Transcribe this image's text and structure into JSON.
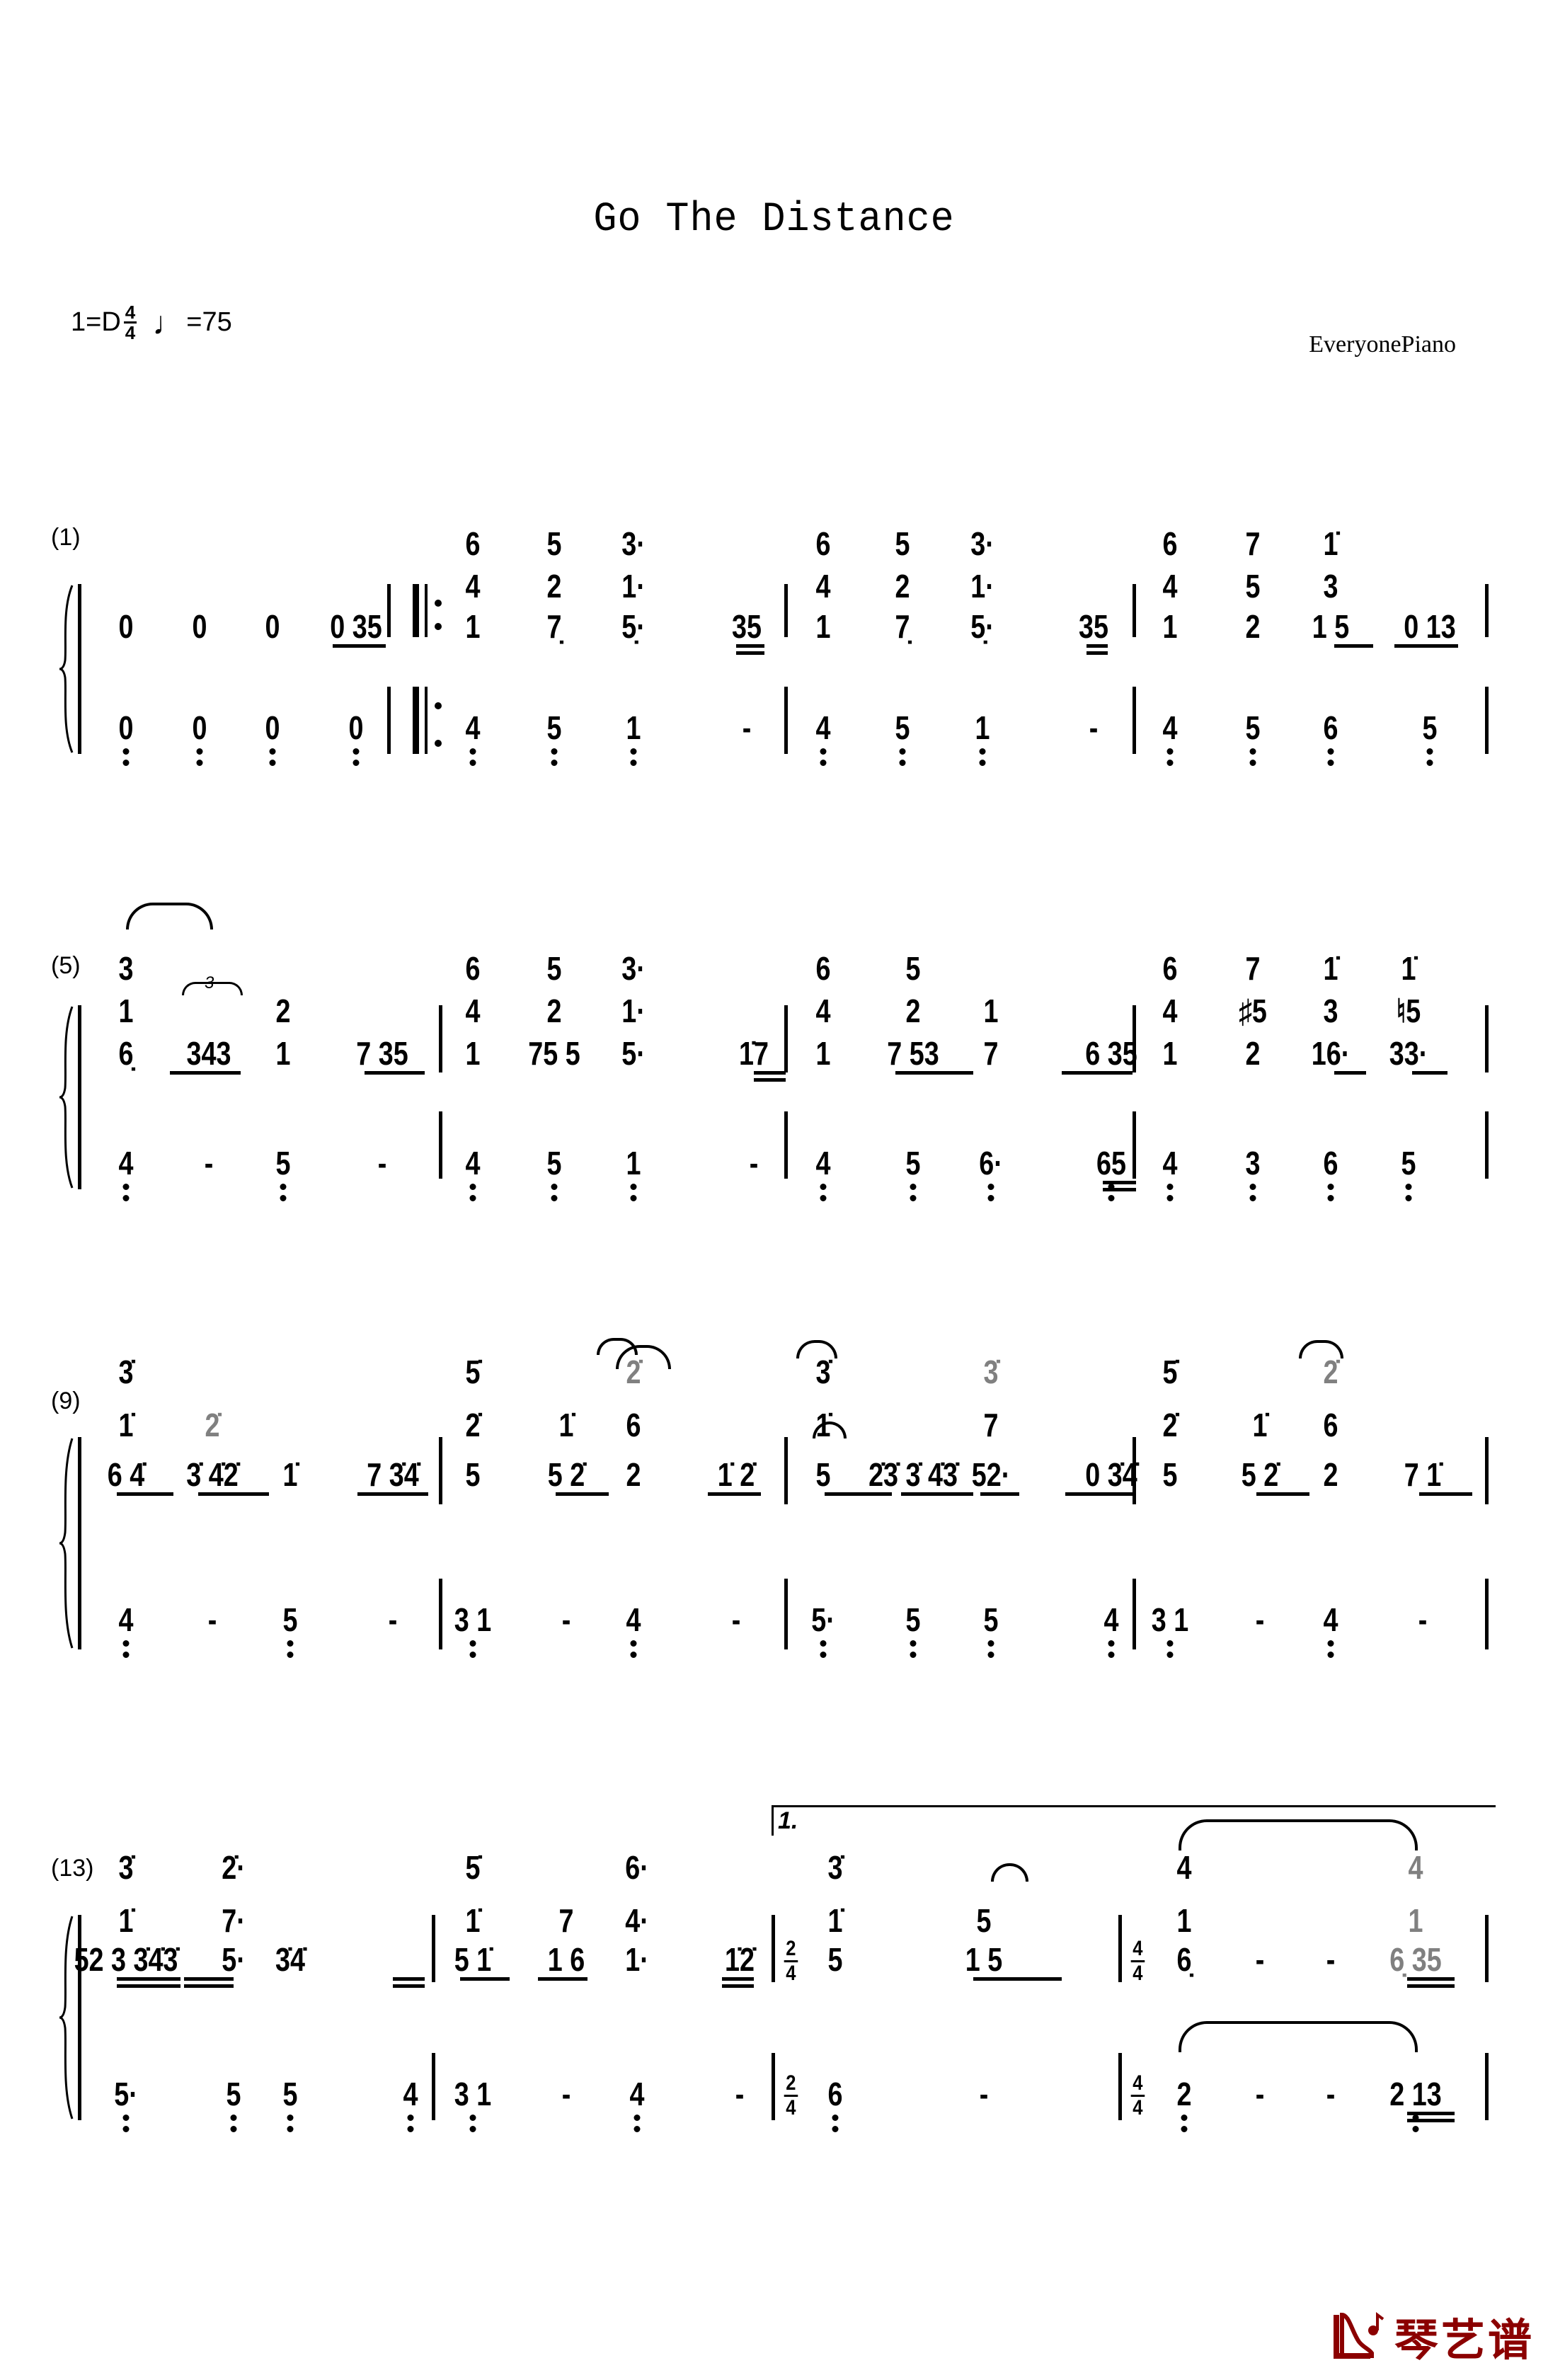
{
  "title": "Go The Distance",
  "key": "1=D",
  "time_signature": {
    "num": "4",
    "den": "4"
  },
  "tempo_symbol": "♩",
  "tempo": "=75",
  "arranger": "EveryonePiano",
  "logo": {
    "icon": "piano-note-icon",
    "text": "琴艺谱",
    "color": "#8b0000"
  },
  "systems": [
    {
      "bar_number": "(1)",
      "measures": [
        {
          "treble": [
            "0",
            "0",
            "0",
            "0 35"
          ],
          "bass": [
            "0",
            "0",
            "0",
            "0"
          ]
        },
        {
          "treble_chords": [
            [
              "1",
              "4",
              "6"
            ],
            [
              "7̣",
              "2",
              "5"
            ],
            [
              "5̣·",
              "1·",
              "3·"
            ],
            [
              "35"
            ]
          ],
          "bass": [
            "4",
            "5",
            "1",
            "-"
          ],
          "start": "repeat-open"
        },
        {
          "treble_chords": [
            [
              "1",
              "4",
              "6"
            ],
            [
              "7̣",
              "2",
              "5"
            ],
            [
              "5̣·",
              "1·",
              "3·"
            ],
            [
              "35"
            ]
          ],
          "bass": [
            "4",
            "5",
            "1",
            "-"
          ]
        },
        {
          "treble_chords": [
            [
              "1",
              "4",
              "6"
            ],
            [
              "2",
              "5",
              "7"
            ],
            [
              "1 5",
              "3",
              "1̇"
            ],
            [
              "0 13"
            ]
          ],
          "bass": [
            "4",
            "5",
            "6",
            "5"
          ]
        }
      ]
    },
    {
      "bar_number": "(5)",
      "measures": [
        {
          "treble_chords": [
            [
              "6̣",
              "1",
              "3"
            ],
            [
              "343"
            ],
            [
              "1",
              "2"
            ],
            [
              "7 35"
            ]
          ],
          "bass": [
            "4",
            "-",
            "5",
            "-"
          ],
          "tuplet": "3"
        },
        {
          "treble_chords": [
            [
              "1",
              "4",
              "6"
            ],
            [
              "75 5",
              "2",
              "5"
            ],
            [
              "5·",
              "1·",
              "3·"
            ],
            [
              "1̇7"
            ]
          ],
          "bass": [
            "4",
            "5",
            "1",
            "-"
          ]
        },
        {
          "treble_chords": [
            [
              "1",
              "4",
              "6"
            ],
            [
              "7 53",
              "2",
              "5"
            ],
            [
              "7",
              "1"
            ],
            [
              "6 35"
            ]
          ],
          "bass": [
            "4",
            "5",
            "6·",
            "65"
          ]
        },
        {
          "treble_chords": [
            [
              "1",
              "4",
              "6"
            ],
            [
              "2",
              "♯5",
              "7"
            ],
            [
              "16·",
              "3",
              "1̇"
            ],
            [
              "33·",
              "♮5",
              "1̇"
            ]
          ],
          "bass": [
            "4",
            "3",
            "6",
            "5"
          ]
        }
      ]
    },
    {
      "bar_number": "(9)",
      "measures": [
        {
          "treble_chords": [
            [
              "6 4̇",
              "1̇",
              "3̇"
            ],
            [
              "3̇ 4̇2̇",
              "2̇"
            ],
            [
              "1̇"
            ],
            [
              "7 3̇4̇"
            ]
          ],
          "bass": [
            "4",
            "-",
            "5",
            "-"
          ]
        },
        {
          "treble_chords": [
            [
              "5",
              "2̇",
              "5̇"
            ],
            [
              "5 2̇",
              "1̇"
            ],
            [
              "2",
              "6",
              "2̇"
            ],
            [
              "1̇ 2̇"
            ]
          ],
          "bass": [
            "3 1",
            "-",
            "4",
            "-"
          ]
        },
        {
          "treble_chords": [
            [
              "5",
              "1̇",
              "3̇"
            ],
            [
              "2̇3̇ 3̇ 4̇3̇"
            ],
            [
              "52·",
              "7",
              "3̇"
            ],
            [
              "0 3̇4̇"
            ]
          ],
          "bass": [
            "5·",
            "5",
            "5",
            "4"
          ]
        },
        {
          "treble_chords": [
            [
              "5",
              "2̇",
              "5̇"
            ],
            [
              "5 2̇",
              "1̇"
            ],
            [
              "2",
              "6",
              "2̇"
            ],
            [
              "7 1̇"
            ]
          ],
          "bass": [
            "3 1",
            "-",
            "4",
            "-"
          ]
        }
      ]
    },
    {
      "bar_number": "(13)",
      "volta": "1.",
      "measures": [
        {
          "treble_chords": [
            [
              "52 3 3̇4̇3̇",
              "1̇",
              "3̇"
            ],
            [
              "5·",
              "7·",
              "2̇·"
            ],
            [
              "3̇4̇"
            ]
          ],
          "bass": [
            "5·",
            "5",
            "5",
            "4"
          ]
        },
        {
          "treble_chords": [
            [
              "5 1̇",
              "1̇",
              "5̇"
            ],
            [
              "1 6",
              "7"
            ],
            [
              "1·",
              "4·",
              "6·"
            ],
            [
              "1̇2̇"
            ]
          ],
          "bass": [
            "3 1",
            "-",
            "4",
            "-"
          ]
        },
        {
          "time_signature": {
            "num": "2",
            "den": "4"
          },
          "treble_chords": [
            [
              "5",
              "1̇",
              "3̇"
            ],
            [
              "1 5",
              "5"
            ]
          ],
          "bass": [
            "6",
            "-"
          ]
        },
        {
          "time_signature": {
            "num": "4",
            "den": "4"
          },
          "treble_chords": [
            [
              "6̣",
              "1",
              "4"
            ],
            [
              "-"
            ],
            [
              "-"
            ],
            [
              "6̣ 35",
              "1",
              "4"
            ]
          ],
          "bass": [
            "2",
            "-",
            "-",
            "2 13"
          ]
        }
      ]
    }
  ]
}
